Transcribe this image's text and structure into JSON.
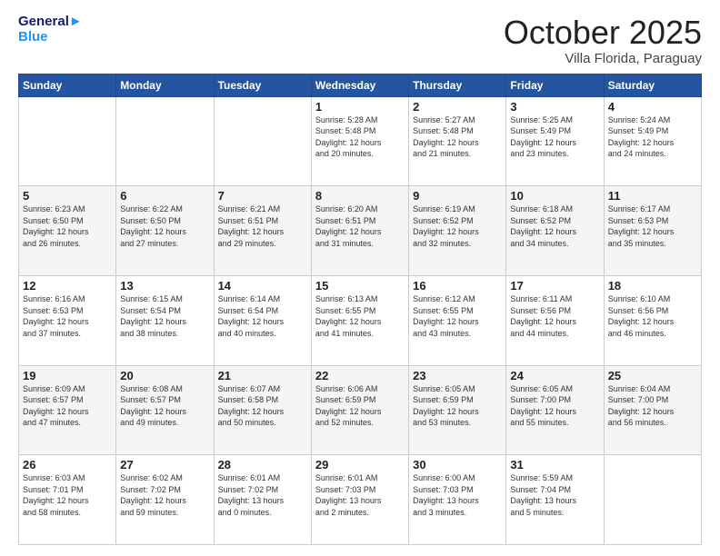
{
  "header": {
    "logo_line1": "General",
    "logo_line2": "Blue",
    "title": "October 2025",
    "subtitle": "Villa Florida, Paraguay"
  },
  "days_of_week": [
    "Sunday",
    "Monday",
    "Tuesday",
    "Wednesday",
    "Thursday",
    "Friday",
    "Saturday"
  ],
  "weeks": [
    [
      {
        "day": "",
        "info": ""
      },
      {
        "day": "",
        "info": ""
      },
      {
        "day": "",
        "info": ""
      },
      {
        "day": "1",
        "info": "Sunrise: 5:28 AM\nSunset: 5:48 PM\nDaylight: 12 hours\nand 20 minutes."
      },
      {
        "day": "2",
        "info": "Sunrise: 5:27 AM\nSunset: 5:48 PM\nDaylight: 12 hours\nand 21 minutes."
      },
      {
        "day": "3",
        "info": "Sunrise: 5:25 AM\nSunset: 5:49 PM\nDaylight: 12 hours\nand 23 minutes."
      },
      {
        "day": "4",
        "info": "Sunrise: 5:24 AM\nSunset: 5:49 PM\nDaylight: 12 hours\nand 24 minutes."
      }
    ],
    [
      {
        "day": "5",
        "info": "Sunrise: 6:23 AM\nSunset: 6:50 PM\nDaylight: 12 hours\nand 26 minutes."
      },
      {
        "day": "6",
        "info": "Sunrise: 6:22 AM\nSunset: 6:50 PM\nDaylight: 12 hours\nand 27 minutes."
      },
      {
        "day": "7",
        "info": "Sunrise: 6:21 AM\nSunset: 6:51 PM\nDaylight: 12 hours\nand 29 minutes."
      },
      {
        "day": "8",
        "info": "Sunrise: 6:20 AM\nSunset: 6:51 PM\nDaylight: 12 hours\nand 31 minutes."
      },
      {
        "day": "9",
        "info": "Sunrise: 6:19 AM\nSunset: 6:52 PM\nDaylight: 12 hours\nand 32 minutes."
      },
      {
        "day": "10",
        "info": "Sunrise: 6:18 AM\nSunset: 6:52 PM\nDaylight: 12 hours\nand 34 minutes."
      },
      {
        "day": "11",
        "info": "Sunrise: 6:17 AM\nSunset: 6:53 PM\nDaylight: 12 hours\nand 35 minutes."
      }
    ],
    [
      {
        "day": "12",
        "info": "Sunrise: 6:16 AM\nSunset: 6:53 PM\nDaylight: 12 hours\nand 37 minutes."
      },
      {
        "day": "13",
        "info": "Sunrise: 6:15 AM\nSunset: 6:54 PM\nDaylight: 12 hours\nand 38 minutes."
      },
      {
        "day": "14",
        "info": "Sunrise: 6:14 AM\nSunset: 6:54 PM\nDaylight: 12 hours\nand 40 minutes."
      },
      {
        "day": "15",
        "info": "Sunrise: 6:13 AM\nSunset: 6:55 PM\nDaylight: 12 hours\nand 41 minutes."
      },
      {
        "day": "16",
        "info": "Sunrise: 6:12 AM\nSunset: 6:55 PM\nDaylight: 12 hours\nand 43 minutes."
      },
      {
        "day": "17",
        "info": "Sunrise: 6:11 AM\nSunset: 6:56 PM\nDaylight: 12 hours\nand 44 minutes."
      },
      {
        "day": "18",
        "info": "Sunrise: 6:10 AM\nSunset: 6:56 PM\nDaylight: 12 hours\nand 46 minutes."
      }
    ],
    [
      {
        "day": "19",
        "info": "Sunrise: 6:09 AM\nSunset: 6:57 PM\nDaylight: 12 hours\nand 47 minutes."
      },
      {
        "day": "20",
        "info": "Sunrise: 6:08 AM\nSunset: 6:57 PM\nDaylight: 12 hours\nand 49 minutes."
      },
      {
        "day": "21",
        "info": "Sunrise: 6:07 AM\nSunset: 6:58 PM\nDaylight: 12 hours\nand 50 minutes."
      },
      {
        "day": "22",
        "info": "Sunrise: 6:06 AM\nSunset: 6:59 PM\nDaylight: 12 hours\nand 52 minutes."
      },
      {
        "day": "23",
        "info": "Sunrise: 6:05 AM\nSunset: 6:59 PM\nDaylight: 12 hours\nand 53 minutes."
      },
      {
        "day": "24",
        "info": "Sunrise: 6:05 AM\nSunset: 7:00 PM\nDaylight: 12 hours\nand 55 minutes."
      },
      {
        "day": "25",
        "info": "Sunrise: 6:04 AM\nSunset: 7:00 PM\nDaylight: 12 hours\nand 56 minutes."
      }
    ],
    [
      {
        "day": "26",
        "info": "Sunrise: 6:03 AM\nSunset: 7:01 PM\nDaylight: 12 hours\nand 58 minutes."
      },
      {
        "day": "27",
        "info": "Sunrise: 6:02 AM\nSunset: 7:02 PM\nDaylight: 12 hours\nand 59 minutes."
      },
      {
        "day": "28",
        "info": "Sunrise: 6:01 AM\nSunset: 7:02 PM\nDaylight: 13 hours\nand 0 minutes."
      },
      {
        "day": "29",
        "info": "Sunrise: 6:01 AM\nSunset: 7:03 PM\nDaylight: 13 hours\nand 2 minutes."
      },
      {
        "day": "30",
        "info": "Sunrise: 6:00 AM\nSunset: 7:03 PM\nDaylight: 13 hours\nand 3 minutes."
      },
      {
        "day": "31",
        "info": "Sunrise: 5:59 AM\nSunset: 7:04 PM\nDaylight: 13 hours\nand 5 minutes."
      },
      {
        "day": "",
        "info": ""
      }
    ]
  ]
}
